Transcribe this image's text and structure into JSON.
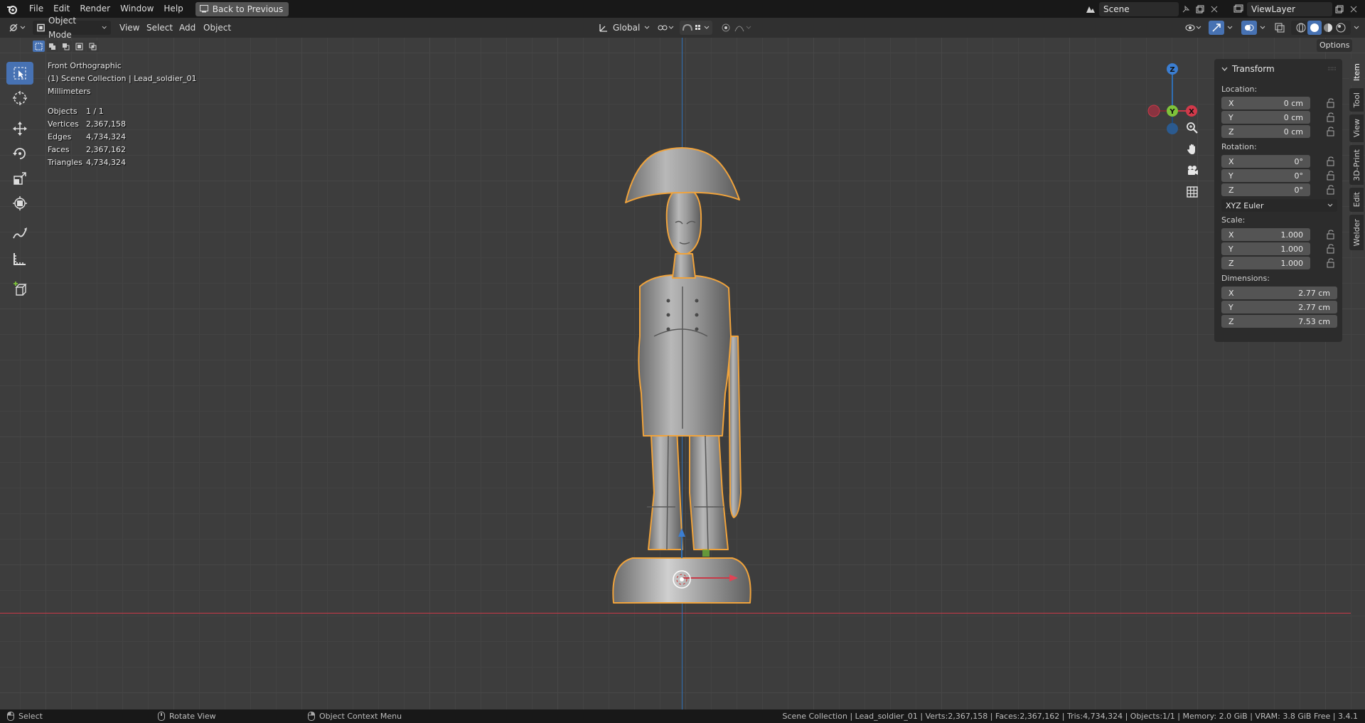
{
  "menu": {
    "items": [
      "File",
      "Edit",
      "Render",
      "Window",
      "Help"
    ],
    "back_label": "Back to Previous"
  },
  "scene": {
    "name": "Scene",
    "view_layer": "ViewLayer"
  },
  "header": {
    "mode": "Object Mode",
    "menus": [
      "View",
      "Select",
      "Add",
      "Object"
    ],
    "orientation": "Global",
    "options_label": "Options"
  },
  "overlay": {
    "view_name": "Front Orthographic",
    "collection": "(1) Scene Collection | Lead_soldier_01",
    "units": "Millimeters",
    "stats": [
      {
        "label": "Objects",
        "value": "1 / 1"
      },
      {
        "label": "Vertices",
        "value": "2,367,158"
      },
      {
        "label": "Edges",
        "value": "4,734,324"
      },
      {
        "label": "Faces",
        "value": "2,367,162"
      },
      {
        "label": "Triangles",
        "value": "4,734,324"
      }
    ]
  },
  "gizmo": {
    "z": "Z",
    "y": "Y",
    "x": "X"
  },
  "panel": {
    "title": "Transform",
    "location_label": "Location:",
    "location": [
      {
        "axis": "X",
        "value": "0 cm"
      },
      {
        "axis": "Y",
        "value": "0 cm"
      },
      {
        "axis": "Z",
        "value": "0 cm"
      }
    ],
    "rotation_label": "Rotation:",
    "rotation": [
      {
        "axis": "X",
        "value": "0°"
      },
      {
        "axis": "Y",
        "value": "0°"
      },
      {
        "axis": "Z",
        "value": "0°"
      }
    ],
    "rotation_mode": "XYZ Euler",
    "scale_label": "Scale:",
    "scale": [
      {
        "axis": "X",
        "value": "1.000"
      },
      {
        "axis": "Y",
        "value": "1.000"
      },
      {
        "axis": "Z",
        "value": "1.000"
      }
    ],
    "dimensions_label": "Dimensions:",
    "dimensions": [
      {
        "axis": "X",
        "value": "2.77 cm"
      },
      {
        "axis": "Y",
        "value": "2.77 cm"
      },
      {
        "axis": "Z",
        "value": "7.53 cm"
      }
    ]
  },
  "side_tabs": [
    "Item",
    "Tool",
    "View",
    "3D-Print",
    "Edit",
    "Welder"
  ],
  "statusbar": {
    "select": "Select",
    "rotate": "Rotate View",
    "context": "Object Context Menu",
    "info": "Scene Collection | Lead_soldier_01 | Verts:2,367,158 | Faces:2,367,162 | Tris:4,734,324 | Objects:1/1 | Memory: 2.0 GiB | VRAM: 3.8 GiB Free | 3.4.1"
  },
  "colors": {
    "accent": "#4772b3",
    "selection_outline": "#f0a33c",
    "axis_x": "#c83a48",
    "axis_y": "#7ec33a",
    "axis_z": "#2f6fb4"
  }
}
